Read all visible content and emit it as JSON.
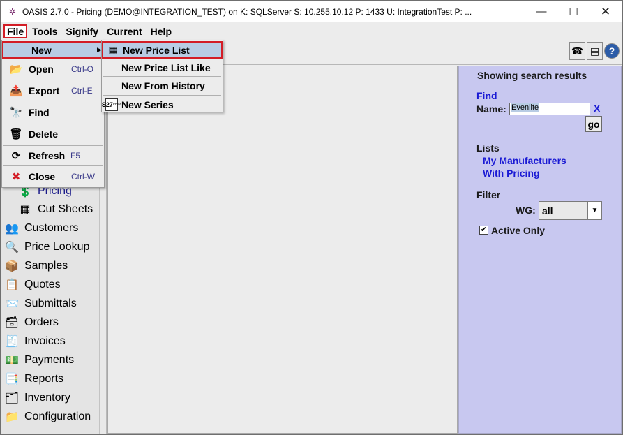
{
  "titlebar": {
    "title": "OASIS 2.7.0 - Pricing (DEMO@INTEGRATION_TEST) on K: SQLServer  S: 10.255.10.12  P: 1433  U: IntegrationTest  P: ...",
    "minimize": "—",
    "maximize": "☐",
    "close": "✕"
  },
  "menubar": {
    "items": [
      "File",
      "Tools",
      "Signify",
      "Current",
      "Help"
    ]
  },
  "file_menu": {
    "new": "New",
    "open": "Open",
    "open_accel": "Ctrl-O",
    "export": "Export",
    "export_accel": "Ctrl-E",
    "find": "Find",
    "delete": "Delete",
    "refresh": "Refresh",
    "refresh_accel": "F5",
    "close": "Close",
    "close_accel": "Ctrl-W"
  },
  "new_submenu": {
    "items": [
      "New Price List",
      "New Price List Like",
      "New From History",
      "New Series"
    ],
    "series_icon_text": "S27",
    "series_icon_sub": "Irblac"
  },
  "leftnav": {
    "items": [
      {
        "label": "Pricing",
        "icon": "pricing-icon"
      },
      {
        "label": "Cut Sheets",
        "icon": "cut-sheets-icon"
      },
      {
        "label": "Customers",
        "icon": "customers-icon"
      },
      {
        "label": "Price Lookup",
        "icon": "price-lookup-icon"
      },
      {
        "label": "Samples",
        "icon": "samples-icon"
      },
      {
        "label": "Quotes",
        "icon": "quotes-icon"
      },
      {
        "label": "Submittals",
        "icon": "submittals-icon"
      },
      {
        "label": "Orders",
        "icon": "orders-icon"
      },
      {
        "label": "Invoices",
        "icon": "invoices-icon"
      },
      {
        "label": "Payments",
        "icon": "payments-icon"
      },
      {
        "label": "Reports",
        "icon": "reports-icon"
      },
      {
        "label": "Inventory",
        "icon": "inventory-icon"
      },
      {
        "label": "Configuration",
        "icon": "configuration-icon"
      }
    ]
  },
  "rightpanel": {
    "heading": "Showing search results",
    "find_label": "Find",
    "name_label": "Name:",
    "name_value": "Evenlite",
    "clear_label": "X",
    "go_label": "go",
    "lists_label": "Lists",
    "list_items": [
      "My Manufacturers",
      "With Pricing"
    ],
    "filter_label": "Filter",
    "wg_label": "WG:",
    "wg_value": "all",
    "active_only_label": "Active Only",
    "active_only_checked": true
  },
  "colors": {
    "panel_bg": "#c8c8f0",
    "link_blue": "#1a1ad4",
    "highlight": "#b8cce4",
    "annotation_red": "#d31d26"
  }
}
